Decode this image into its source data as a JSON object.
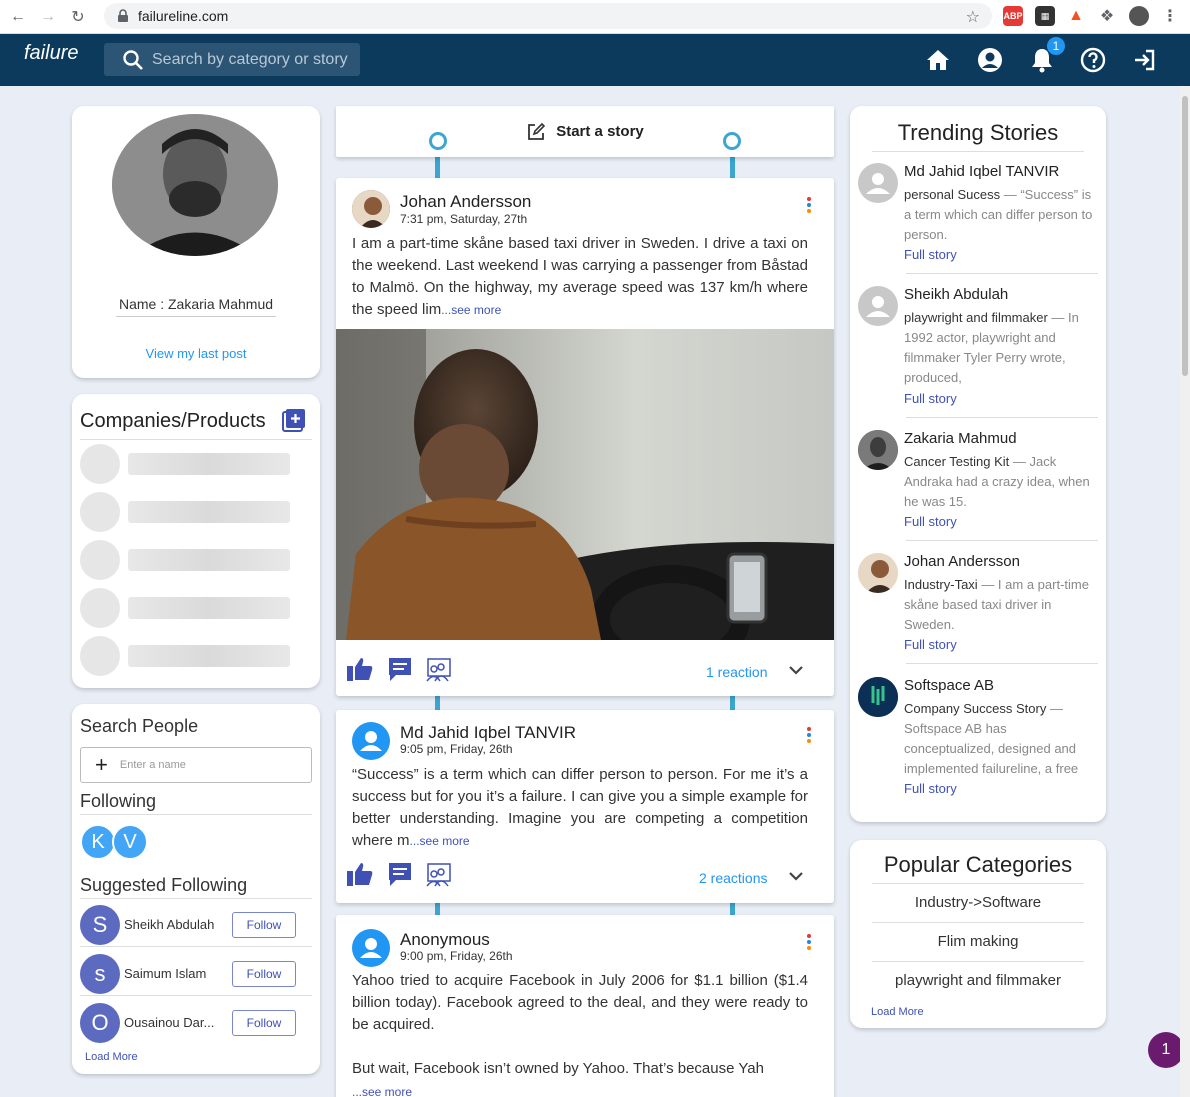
{
  "browser": {
    "url": "failureline.com",
    "ext_abp": "ABP"
  },
  "header": {
    "logo_text": "failure",
    "search_placeholder": "Search by category or story",
    "notification_count": "1"
  },
  "profile": {
    "name": "Name : Zakaria Mahmud",
    "view_post": "View my last post"
  },
  "companies": {
    "title": "Companies/Products"
  },
  "people": {
    "search_title": "Search People",
    "search_placeholder": "Enter a name",
    "following_title": "Following",
    "following": [
      "K",
      "V"
    ],
    "suggested_title": "Suggested Following",
    "suggested": [
      {
        "initial": "S",
        "name": "Sheikh Abdulah",
        "button": "Follow"
      },
      {
        "initial": "s",
        "name": "Saimum Islam",
        "button": "Follow"
      },
      {
        "initial": "O",
        "name": "Ousainou Dar...",
        "button": "Follow"
      }
    ],
    "load_more": "Load More"
  },
  "composer": {
    "label": "Start a story"
  },
  "posts": [
    {
      "author": "Johan Andersson",
      "time": "7:31 pm, Saturday, 27th",
      "text": "I am a part-time skåne based taxi driver in Sweden. I drive a taxi on the weekend. Last weekend I was carrying a passenger from Båstad to Malmö. On the highway, my average speed was 137 km/h where the speed lim",
      "see_more": "...see more",
      "reactions": "1 reaction"
    },
    {
      "author": "Md Jahid Iqbel TANVIR",
      "time": "9:05 pm, Friday, 26th",
      "text": "“Success” is a term which can differ person to person. For me it’s a success but for you it’s a failure. I can give you a simple example for better understanding. Imagine you are competing a competition where m",
      "see_more": "...see more",
      "reactions": "2 reactions"
    },
    {
      "author": "Anonymous",
      "time": "9:00 pm, Friday, 26th",
      "text": "Yahoo tried to acquire Facebook in July 2006 for $1.1 billion ($1.4 billion today). Facebook agreed to the deal, and they were ready to be acquired.",
      "text2": "But wait, Facebook isn’t owned by Yahoo. That’s because Yah",
      "see_more": "...see more"
    }
  ],
  "trending": {
    "title": "Trending Stories",
    "items": [
      {
        "name": "Md Jahid Iqbel TANVIR",
        "category": "personal Sucess",
        "summary": " — “Success” is a term which can differ person to person.",
        "link": "Full story"
      },
      {
        "name": "Sheikh Abdulah",
        "category": "playwright and filmmaker",
        "summary": " — In 1992 actor, playwright and filmmaker Tyler Perry wrote, produced,",
        "link": "Full story"
      },
      {
        "name": "Zakaria Mahmud",
        "category": "Cancer Testing Kit",
        "summary": " — Jack Andraka had a crazy idea, when he was 15.",
        "link": "Full story"
      },
      {
        "name": "Johan Andersson",
        "category": "Industry-Taxi",
        "summary": " — I am a part-time skåne based taxi driver in Sweden.",
        "link": "Full story"
      },
      {
        "name": "Softspace AB",
        "category": "Company Success Story",
        "summary": " — Softspace AB has conceptualized, designed and implemented failureline, a free",
        "link": "Full story"
      }
    ]
  },
  "popular": {
    "title": "Popular Categories",
    "items": [
      "Industry->Software",
      "Flim making",
      "playwright and filmmaker"
    ],
    "load_more": "Load More"
  },
  "chat_badge": "1"
}
